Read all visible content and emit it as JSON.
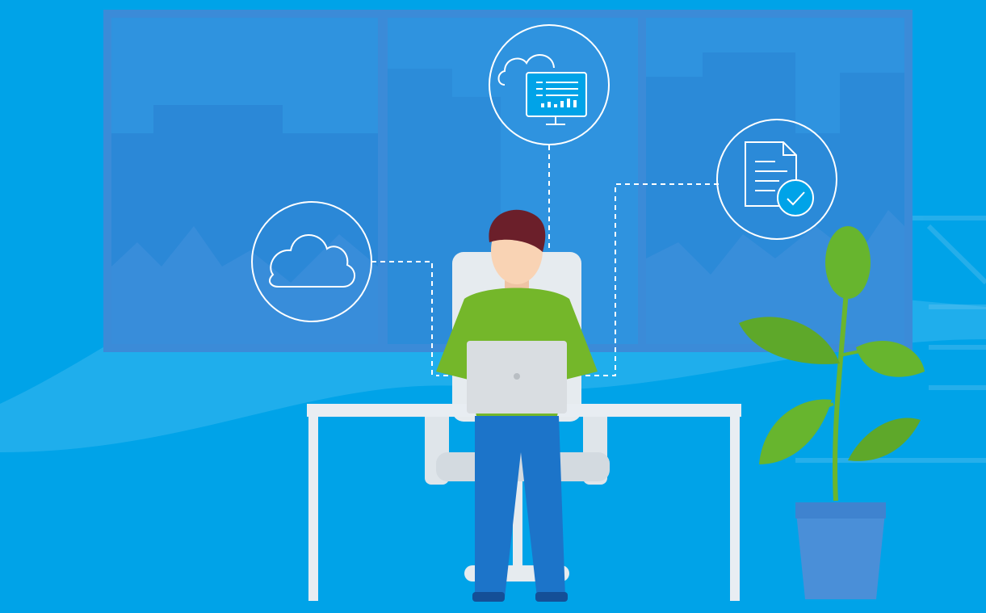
{
  "illustration": {
    "subject": "person-working-on-laptop",
    "icons": [
      "cloud-icon",
      "cloud-dashboard-icon",
      "document-check-icon"
    ],
    "colors": {
      "background": "#00a3e8",
      "window_frame": "#3b8bd8",
      "window_glass": "#2f90de",
      "shirt": "#74b72a",
      "hair": "#6b1f2a",
      "skin": "#f9d3b4",
      "pants": "#1c74c9",
      "desk": "#e8edf2",
      "laptop": "#d9dde1",
      "plant_leaf": "#67b52e",
      "pot": "#4a8fd8",
      "icon_stroke": "#ffffff"
    }
  }
}
